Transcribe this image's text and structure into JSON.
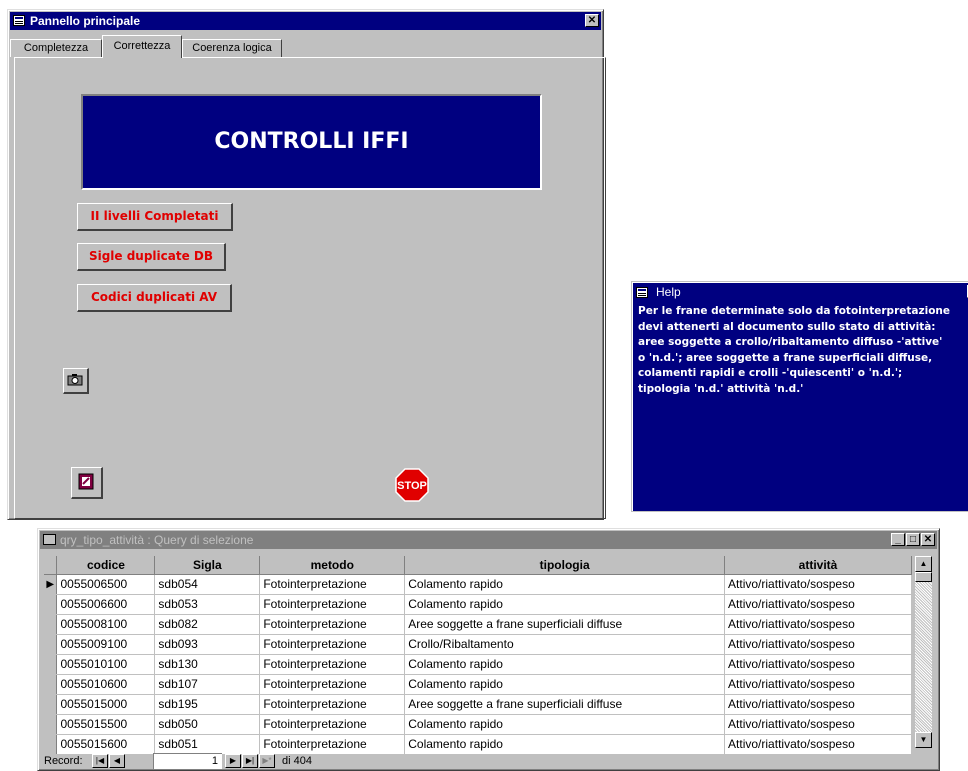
{
  "main_window": {
    "title": "Pannello principale",
    "close_glyph": "✕",
    "tabs": [
      {
        "label": "Completezza",
        "active": false
      },
      {
        "label": "Correttezza",
        "active": true
      },
      {
        "label": "Coerenza logica",
        "active": false
      }
    ],
    "banner": "CONTROLLI IFFI",
    "buttons": [
      "II livelli Completati",
      "Sigle duplicate DB",
      "Codici duplicati AV"
    ],
    "stop_label": "STOP"
  },
  "help_window": {
    "title": "Help",
    "close_glyph": "✕",
    "text": "Per le frane determinate solo da fotointerpretazione\ndevi attenerti al documento sullo stato di attività:\naree soggette a crollo/ribaltamento diffuso -'attive'\no 'n.d.'; aree soggette a frane superficiali diffuse,\ncolamenti rapidi e crolli -'quiescenti' o 'n.d.';\ntipologia 'n.d.' attività 'n.d.'"
  },
  "query_window": {
    "title": "qry_tipo_attività : Query di selezione",
    "columns": [
      "codice",
      "Sigla",
      "metodo",
      "tipologia",
      "attività"
    ],
    "rows": [
      [
        "0055006500",
        "sdb054",
        "Fotointerpretazione",
        "Colamento rapido",
        "Attivo/riattivato/sospeso"
      ],
      [
        "0055006600",
        "sdb053",
        "Fotointerpretazione",
        "Colamento rapido",
        "Attivo/riattivato/sospeso"
      ],
      [
        "0055008100",
        "sdb082",
        "Fotointerpretazione",
        "Aree soggette a frane superficiali diffuse",
        "Attivo/riattivato/sospeso"
      ],
      [
        "0055009100",
        "sdb093",
        "Fotointerpretazione",
        "Crollo/Ribaltamento",
        "Attivo/riattivato/sospeso"
      ],
      [
        "0055010100",
        "sdb130",
        "Fotointerpretazione",
        "Colamento rapido",
        "Attivo/riattivato/sospeso"
      ],
      [
        "0055010600",
        "sdb107",
        "Fotointerpretazione",
        "Colamento rapido",
        "Attivo/riattivato/sospeso"
      ],
      [
        "0055015000",
        "sdb195",
        "Fotointerpretazione",
        "Aree soggette a frane superficiali diffuse",
        "Attivo/riattivato/sospeso"
      ],
      [
        "0055015500",
        "sdb050",
        "Fotointerpretazione",
        "Colamento rapido",
        "Attivo/riattivato/sospeso"
      ],
      [
        "0055015600",
        "sdb051",
        "Fotointerpretazione",
        "Colamento rapido",
        "Attivo/riattivato/sospeso"
      ]
    ],
    "nav": {
      "record_label": "Record:",
      "current": "1",
      "total": "di 404"
    }
  }
}
